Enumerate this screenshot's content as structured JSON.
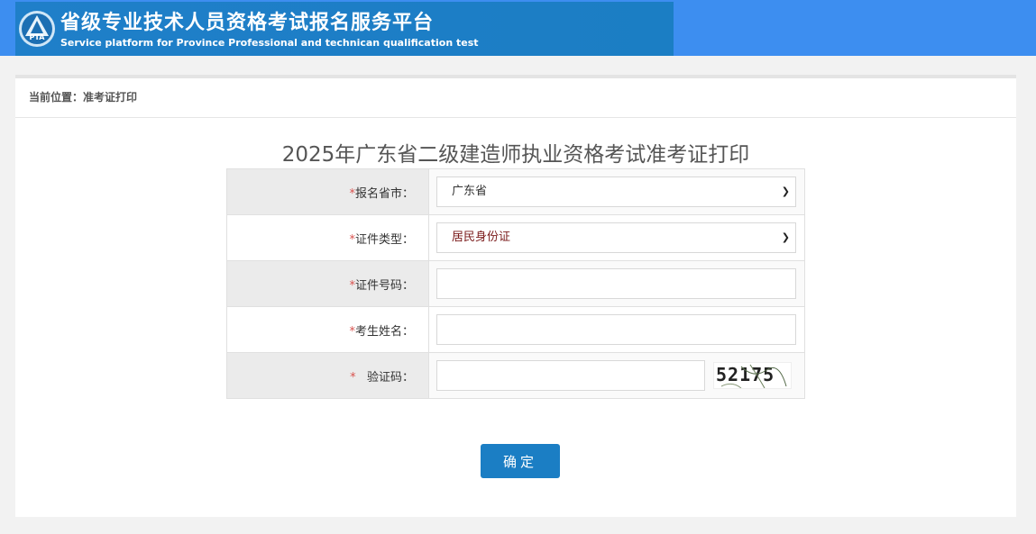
{
  "header": {
    "title": "省级专业技术人员资格考试报名服务平台",
    "subtitle": "Service platform for Province Professional and technican qualification test",
    "logo_text": "PTA"
  },
  "breadcrumb": {
    "text": "当前位置：准考证打印"
  },
  "page_title": "2025年广东省二级建造师执业资格考试准考证打印",
  "form": {
    "province": {
      "required_mark": "*",
      "label": "报名省市：",
      "value": "广东省"
    },
    "id_type": {
      "required_mark": "*",
      "label": "证件类型：",
      "value": "居民身份证"
    },
    "id_number": {
      "required_mark": "*",
      "label": "证件号码：",
      "value": ""
    },
    "name": {
      "required_mark": "*",
      "label": "考生姓名：",
      "value": ""
    },
    "captcha": {
      "required_mark": "*",
      "label": "验证码：",
      "value": "",
      "image_text": "52175"
    }
  },
  "submit_label": "确定",
  "colors": {
    "header_bg": "#3d8ef0",
    "banner_bg": "#1f7fc9",
    "button_bg": "#1b7ec4",
    "required": "#d9534f"
  }
}
